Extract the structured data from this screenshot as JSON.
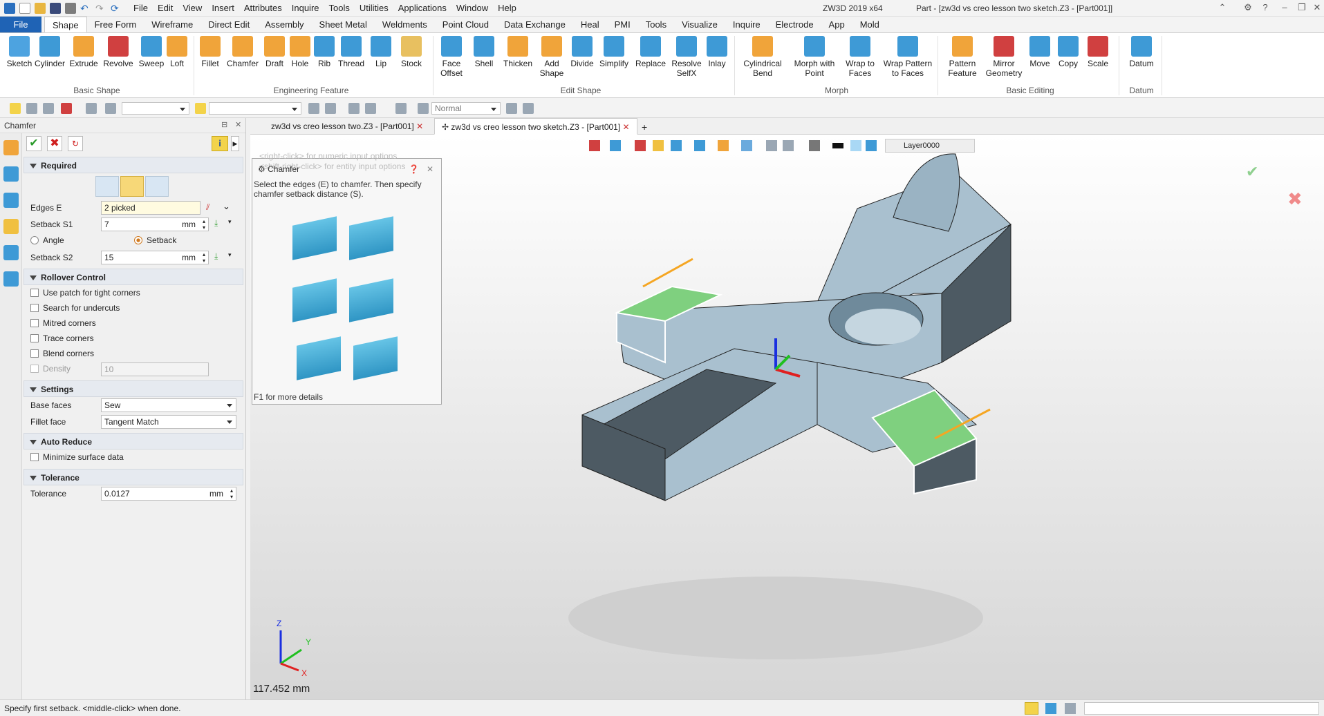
{
  "titlebar": {
    "menu": [
      "File",
      "Edit",
      "View",
      "Insert",
      "Attributes",
      "Inquire",
      "Tools",
      "Utilities",
      "Applications",
      "Window",
      "Help"
    ],
    "app_title": "ZW3D 2019  x64",
    "doc_title": "Part - [zw3d vs creo lesson two sketch.Z3 - [Part001]]"
  },
  "ribbon_tabs": [
    "File",
    "Shape",
    "Free Form",
    "Wireframe",
    "Direct Edit",
    "Assembly",
    "Sheet Metal",
    "Weldments",
    "Point Cloud",
    "Data Exchange",
    "Heal",
    "PMI",
    "Tools",
    "Visualize",
    "Inquire",
    "Electrode",
    "App",
    "Mold"
  ],
  "ribbon": {
    "basic_shape": {
      "label": "Basic Shape",
      "buttons": [
        "Sketch",
        "Cylinder",
        "Extrude",
        "Revolve",
        "Sweep",
        "Loft"
      ]
    },
    "engineering_feature": {
      "label": "Engineering Feature",
      "buttons": [
        "Fillet",
        "Chamfer",
        "Draft",
        "Hole",
        "Rib",
        "Thread",
        "Lip",
        "Stock"
      ]
    },
    "edit_shape": {
      "label": "Edit Shape",
      "buttons": [
        "Face Offset",
        "Shell",
        "Thicken",
        "Add Shape",
        "Divide",
        "Simplify",
        "Replace",
        "Resolve SelfX",
        "Inlay"
      ]
    },
    "morph": {
      "label": "Morph",
      "buttons": [
        "Cylindrical Bend",
        "Morph with Point",
        "Wrap to Faces",
        "Wrap Pattern to Faces"
      ]
    },
    "basic_editing": {
      "label": "Basic Editing",
      "buttons": [
        "Pattern Feature",
        "Mirror Geometry",
        "Move",
        "Copy",
        "Scale"
      ]
    },
    "datum": {
      "label": "Datum",
      "buttons": [
        "Datum"
      ]
    }
  },
  "toolbar2": {
    "filter_value": "Normal",
    "layer": "Layer0000"
  },
  "left_panel": {
    "title": "Chamfer",
    "required": {
      "header": "Required",
      "edges_label": "Edges E",
      "edges_value": "2 picked",
      "setback_s1_label": "Setback S1",
      "setback_s1_value": "7",
      "unit": "mm",
      "angle_label": "Angle",
      "setback_label": "Setback",
      "setback_s2_label": "Setback S2",
      "setback_s2_value": "15"
    },
    "rollover": {
      "header": "Rollover Control",
      "items": [
        "Use patch for tight corners",
        "Search for undercuts",
        "Mitred corners",
        "Trace corners",
        "Blend corners"
      ],
      "density_label": "Density",
      "density_value": "10"
    },
    "settings": {
      "header": "Settings",
      "base_faces_label": "Base faces",
      "base_faces_value": "Sew",
      "fillet_face_label": "Fillet face",
      "fillet_face_value": "Tangent Match"
    },
    "auto_reduce": {
      "header": "Auto Reduce",
      "item": "Minimize surface data"
    },
    "tolerance": {
      "header": "Tolerance",
      "label": "Tolerance",
      "value": "0.0127"
    }
  },
  "doc_tabs": [
    "zw3d vs creo lesson two.Z3 - [Part001]",
    "zw3d vs creo lesson two sketch.Z3 - [Part001]"
  ],
  "tooltip": {
    "hint1": "<right-click> for numeric input options",
    "hint2": "<shift-right-click> for entity input options",
    "title": "Chamfer",
    "desc": "Select the edges (E) to chamfer. Then specify chamfer setback distance (S).",
    "footer": "F1 for more details"
  },
  "viewport": {
    "measure": "117.452 mm"
  },
  "status": {
    "text": "Specify first setback. <middle-click> when done."
  },
  "colors": {
    "file_tab": "#1f63b5",
    "model_face": "#a9c0cf",
    "model_dark": "#4d5a63",
    "chamfer_green": "#7fd07f",
    "edge_orange": "#f5a623"
  }
}
